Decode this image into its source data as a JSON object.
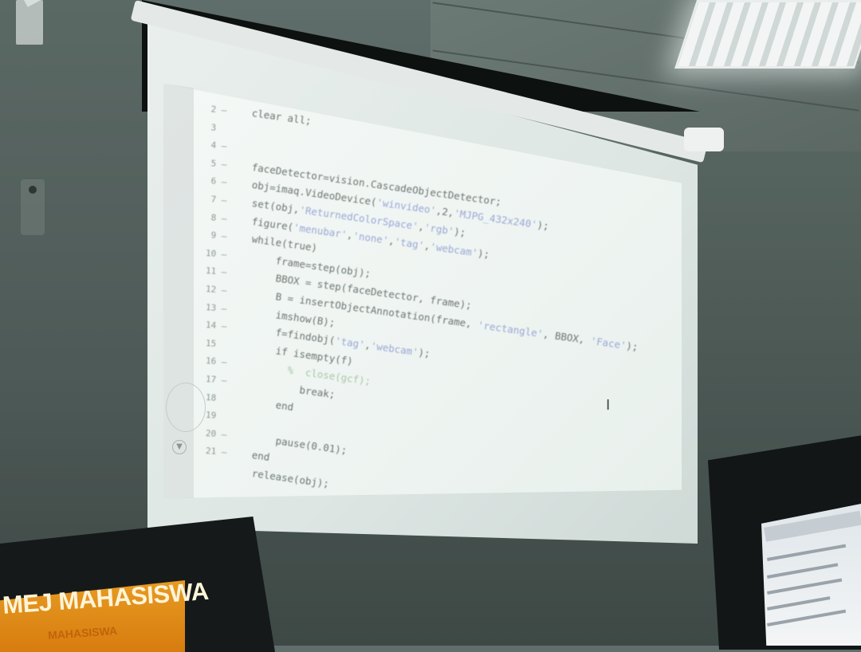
{
  "projector": {
    "code_lines": [
      {
        "n": "2",
        "dash": "–",
        "text": "clear all;"
      },
      {
        "n": "3",
        "dash": "",
        "text": ""
      },
      {
        "n": "4",
        "dash": "–",
        "text": ""
      },
      {
        "n": "5",
        "dash": "–",
        "text": "faceDetector=vision.CascadeObjectDetector;"
      },
      {
        "n": "6",
        "dash": "–",
        "text": "obj=imaq.VideoDevice('winvideo',2,'MJPG_432x240');"
      },
      {
        "n": "7",
        "dash": "–",
        "text": "set(obj,'ReturnedColorSpace','rgb');"
      },
      {
        "n": "8",
        "dash": "–",
        "text": "figure('menubar','none','tag','webcam');"
      },
      {
        "n": "9",
        "dash": "–",
        "text": "while(true)"
      },
      {
        "n": "10",
        "dash": "–",
        "text": "    frame=step(obj);"
      },
      {
        "n": "11",
        "dash": "–",
        "text": "    BBOX = step(faceDetector, frame);"
      },
      {
        "n": "12",
        "dash": "–",
        "text": "    B = insertObjectAnnotation(frame, 'rectangle', BBOX, 'Face');"
      },
      {
        "n": "13",
        "dash": "–",
        "text": "    imshow(B);"
      },
      {
        "n": "14",
        "dash": "–",
        "text": "    f=findobj('tag','webcam');"
      },
      {
        "n": "15",
        "dash": "",
        "text": "    if isempty(f)"
      },
      {
        "n": "16",
        "dash": "–",
        "text": "      %  close(gcf);"
      },
      {
        "n": "17",
        "dash": "–",
        "text": "        break;"
      },
      {
        "n": "18",
        "dash": "",
        "text": "    end"
      },
      {
        "n": "19",
        "dash": "",
        "text": ""
      },
      {
        "n": "20",
        "dash": "–",
        "text": "    pause(0.01);"
      },
      {
        "n": "21",
        "dash": "–",
        "text": "end"
      },
      {
        "n": "",
        "dash": "",
        "text": "release(obj);"
      }
    ]
  },
  "laptop_left": {
    "title": "MEJ MAHASISWA",
    "subtitle": "MAHASISWA"
  },
  "colors": {
    "wall": "#55625e",
    "slide": "#eef4f1",
    "code_text": "#6b7572",
    "laptop_banner": "#e08a18"
  }
}
